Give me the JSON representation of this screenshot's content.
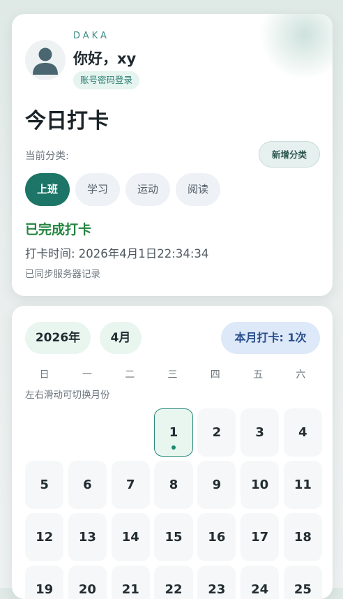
{
  "header": {
    "brand": "DAKA",
    "greeting": "你好，xy",
    "login_badge": "账号密码登录",
    "avatar_icon": "user-avatar-icon"
  },
  "checkin": {
    "title": "今日打卡",
    "category_label": "当前分类:",
    "new_category_button": "新增分类",
    "categories": [
      {
        "label": "上班",
        "active": true
      },
      {
        "label": "学习",
        "active": false
      },
      {
        "label": "运动",
        "active": false
      },
      {
        "label": "阅读",
        "active": false
      }
    ],
    "status": "已完成打卡",
    "time_text": "打卡时间: 2026年4月1日22:34:34",
    "sync_text": "已同步服务器记录"
  },
  "calendar": {
    "year_label": "2026年",
    "month_label": "4月",
    "month_count": "本月打卡: 1次",
    "weekdays": [
      "日",
      "一",
      "二",
      "三",
      "四",
      "五",
      "六"
    ],
    "hint": "左右滑动可切换月份",
    "leading_blanks": 3,
    "days": [
      "1",
      "2",
      "3",
      "4",
      "5",
      "6",
      "7",
      "8",
      "9",
      "10",
      "11",
      "12",
      "13",
      "14",
      "15",
      "16",
      "17",
      "18",
      "19",
      "20",
      "21",
      "22",
      "23",
      "24",
      "25"
    ],
    "today": "1",
    "checked_days": [
      "1"
    ]
  },
  "colors": {
    "accent": "#1c7566",
    "success": "#23843f",
    "count_pill": "#dde8f8"
  }
}
